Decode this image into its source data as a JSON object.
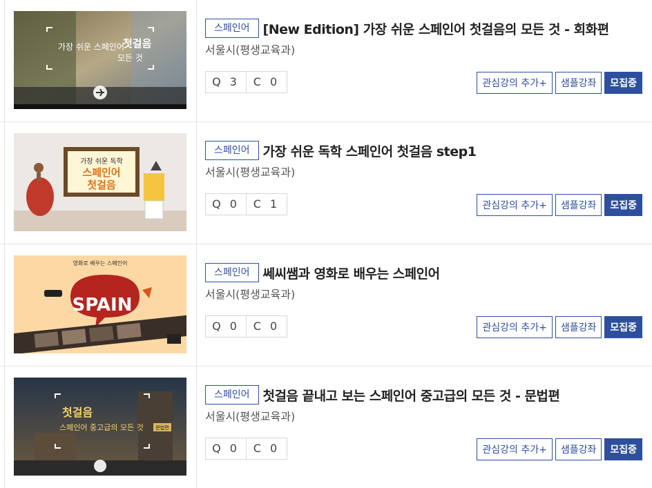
{
  "courses": [
    {
      "badge": "스페인어",
      "title": "[New Edition] 가장 쉬운 스페인어 첫걸음의 모든 것 - 회화편",
      "org": "서울시(평생교육과)",
      "q": "Q 3",
      "c": "C 0",
      "thumb": {
        "main": "가장 쉬운 스페인어",
        "accent": "첫걸음",
        "sub": "모든 것",
        "icon": "airplane-icon"
      }
    },
    {
      "badge": "스페인어",
      "title": "가장 쉬운 독학 스페인어 첫걸음 step1",
      "org": "서울시(평생교육과)",
      "q": "Q 0",
      "c": "C 1",
      "thumb": {
        "line1": "가장 쉬운 독학",
        "line2": "스페인어",
        "line3": "첫걸음"
      }
    },
    {
      "badge": "스페인어",
      "title": "쎄씨쌤과 영화로 배우는 스페인어",
      "org": "서울시(평생교육과)",
      "q": "Q 0",
      "c": "C 0",
      "thumb": {
        "bubble": "SPAIN",
        "top": "영화로 배우는 스페인어"
      }
    },
    {
      "badge": "스페인어",
      "title": "첫걸음 끝내고 보는 스페인어 중고급의 모든 것 - 문법편",
      "org": "서울시(평생교육과)",
      "q": "Q 0",
      "c": "C 0",
      "thumb": {
        "accent": "첫걸음",
        "main": "스페인어 중고급의 모든 것",
        "tag": "문법편"
      }
    }
  ],
  "buttons": {
    "wishlist": "관심강의 추가+",
    "sample": "샘플강좌",
    "recruiting": "모집중"
  },
  "colors": {
    "accent": "#2d4f9e",
    "border": "#e3e3e3"
  }
}
